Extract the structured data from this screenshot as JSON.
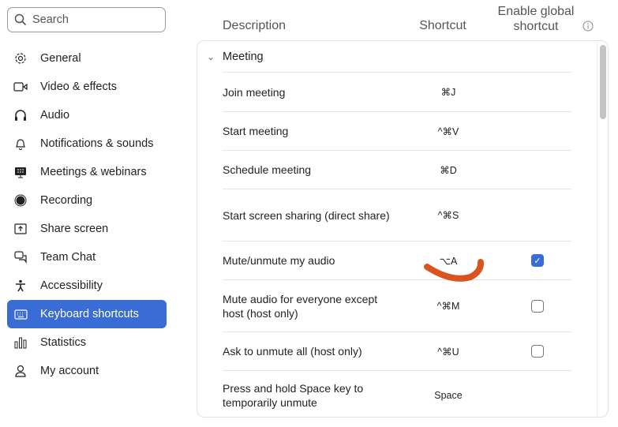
{
  "search": {
    "placeholder": "Search"
  },
  "sidebar": {
    "items": [
      {
        "label": "General",
        "icon": "gear-icon"
      },
      {
        "label": "Video & effects",
        "icon": "video-icon"
      },
      {
        "label": "Audio",
        "icon": "headphones-icon"
      },
      {
        "label": "Notifications & sounds",
        "icon": "bell-icon"
      },
      {
        "label": "Meetings & webinars",
        "icon": "meetings-icon"
      },
      {
        "label": "Recording",
        "icon": "record-icon"
      },
      {
        "label": "Share screen",
        "icon": "share-screen-icon"
      },
      {
        "label": "Team Chat",
        "icon": "chat-icon"
      },
      {
        "label": "Accessibility",
        "icon": "accessibility-icon"
      },
      {
        "label": "Keyboard shortcuts",
        "icon": "keyboard-icon",
        "active": true
      },
      {
        "label": "Statistics",
        "icon": "statistics-icon"
      },
      {
        "label": "My account",
        "icon": "user-icon"
      }
    ]
  },
  "table": {
    "headers": {
      "description": "Description",
      "shortcut": "Shortcut",
      "global_line1": "Enable global",
      "global_line2": "shortcut"
    },
    "group": "Meeting",
    "rows": [
      {
        "description": "Join meeting",
        "shortcut": "⌘J",
        "global": null
      },
      {
        "description": "Start meeting",
        "shortcut": "^⌘V",
        "global": null
      },
      {
        "description": "Schedule meeting",
        "shortcut": "⌘D",
        "global": null
      },
      {
        "description": "Start screen sharing (direct share)",
        "shortcut": "^⌘S",
        "global": null
      },
      {
        "description": "Mute/unmute my audio",
        "shortcut": "⌥A",
        "global": true
      },
      {
        "description": "Mute audio for everyone except host (host only)",
        "shortcut": "^⌘M",
        "global": false
      },
      {
        "description": "Ask to unmute all (host only)",
        "shortcut": "^⌘U",
        "global": false
      },
      {
        "description": "Press and hold Space key to temporarily unmute",
        "shortcut": "Space",
        "global": null
      }
    ]
  },
  "colors": {
    "accent": "#3a6cd6",
    "annotation": "#d9541e"
  }
}
